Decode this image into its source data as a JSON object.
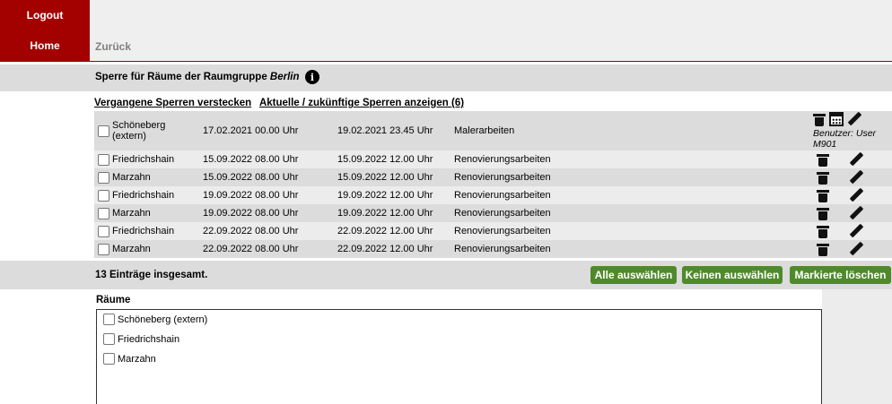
{
  "nav": {
    "logout": "Logout",
    "home": "Home",
    "back": "Zurück"
  },
  "header": {
    "title_prefix": "Sperre für Räume der Raumgruppe ",
    "group": "Berlin"
  },
  "links": {
    "hide_past": "Vergangene Sperren verstecken",
    "show_current": "Aktuelle / zukünftige Sperren anzeigen (6)"
  },
  "rows": [
    {
      "room_line1": "Schöneberg",
      "room_line2": "(extern)",
      "from": "17.02.2021 00.00 Uhr",
      "to": "19.02.2021 23.45 Uhr",
      "reason": "Malerarbeiten",
      "user_note": "Benutzer: User M901"
    },
    {
      "room": "Friedrichshain",
      "from": "15.09.2022 08.00 Uhr",
      "to": "15.09.2022 12.00 Uhr",
      "reason": "Renovierungsarbeiten"
    },
    {
      "room": "Marzahn",
      "from": "15.09.2022 08.00 Uhr",
      "to": "15.09.2022 12.00 Uhr",
      "reason": "Renovierungsarbeiten"
    },
    {
      "room": "Friedrichshain",
      "from": "19.09.2022 08.00 Uhr",
      "to": "19.09.2022 12.00 Uhr",
      "reason": "Renovierungsarbeiten"
    },
    {
      "room": "Marzahn",
      "from": "19.09.2022 08.00 Uhr",
      "to": "19.09.2022 12.00 Uhr",
      "reason": "Renovierungsarbeiten"
    },
    {
      "room": "Friedrichshain",
      "from": "22.09.2022 08.00 Uhr",
      "to": "22.09.2022 12.00 Uhr",
      "reason": "Renovierungsarbeiten"
    },
    {
      "room": "Marzahn",
      "from": "22.09.2022 08.00 Uhr",
      "to": "22.09.2022 12.00 Uhr",
      "reason": "Renovierungsarbeiten"
    }
  ],
  "footer": {
    "total": "13 Einträge insgesamt.",
    "select_all": "Alle auswählen",
    "select_none": "Keinen auswählen",
    "delete_marked": "Markierte löschen"
  },
  "rooms": {
    "label": "Räume",
    "options": [
      "Schöneberg (extern)",
      "Friedrichshain",
      "Marzahn"
    ]
  },
  "colors": {
    "nav_red": "#a30000",
    "button_green": "#4f8a2a"
  }
}
